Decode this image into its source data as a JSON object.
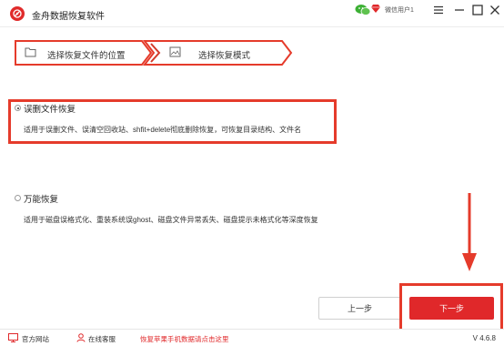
{
  "app": {
    "title": "金舟数据恢复软件",
    "user_name": "微信用户1"
  },
  "window_controls": {
    "menu_icon": "menu-icon",
    "minimize_icon": "minimize-icon",
    "maximize_icon": "maximize-icon",
    "close_icon": "close-icon"
  },
  "steps": [
    {
      "label": "选择恢复文件的位置",
      "icon": "folder-icon"
    },
    {
      "label": "选择恢复模式",
      "icon": "image-icon"
    }
  ],
  "options": [
    {
      "title": "误删文件恢复",
      "desc": "适用于误删文件、误清空回收站、shfit+delete彻底删除恢复，可恢复目录结构、文件名",
      "selected": true
    },
    {
      "title": "万能恢复",
      "desc": "适用于磁盘误格式化、重装系统误ghost、磁盘文件异常丢失、磁盘提示未格式化等深度恢复",
      "selected": false
    }
  ],
  "buttons": {
    "prev": "上一步",
    "next": "下一步"
  },
  "footer": {
    "website": "官方网站",
    "service": "在线客服",
    "promo": "恢复苹果手机数据请点击这里",
    "version": "V 4.6.8"
  },
  "colors": {
    "accent": "#e0282a",
    "annotation": "#e53b2b"
  }
}
